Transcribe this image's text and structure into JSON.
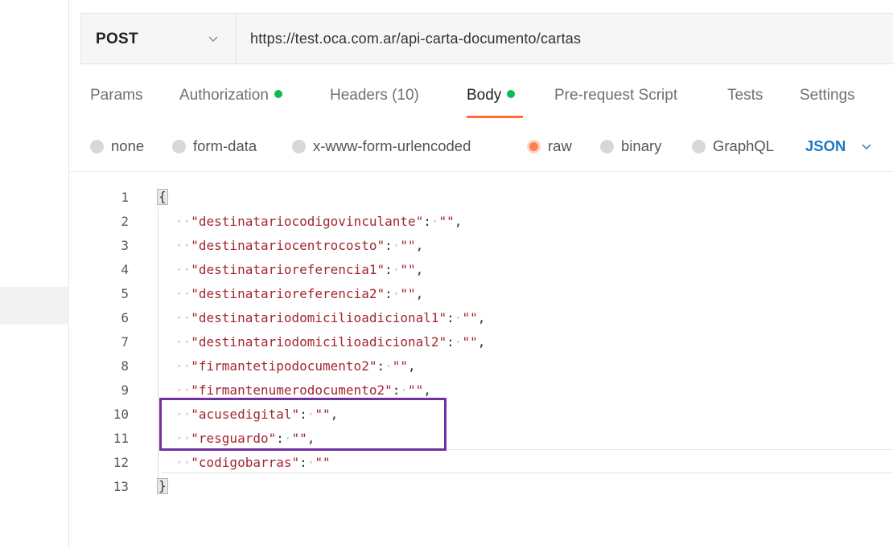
{
  "request": {
    "method": "POST",
    "url": "https://test.oca.com.ar/api-carta-documento/cartas"
  },
  "tabs": [
    {
      "label": "Params",
      "dot": false
    },
    {
      "label": "Authorization",
      "dot": true
    },
    {
      "label": "Headers (10)",
      "dot": false
    },
    {
      "label": "Body",
      "dot": true,
      "active": true
    },
    {
      "label": "Pre-request Script",
      "dot": false
    },
    {
      "label": "Tests",
      "dot": false
    },
    {
      "label": "Settings",
      "dot": false
    }
  ],
  "body_types": {
    "none": "none",
    "form_data": "form-data",
    "urlencoded": "x-www-form-urlencoded",
    "raw": "raw",
    "binary": "binary",
    "graphql": "GraphQL",
    "selected": "raw",
    "format": "JSON"
  },
  "editor": {
    "line_numbers": [
      "1",
      "2",
      "3",
      "4",
      "5",
      "6",
      "7",
      "8",
      "9",
      "10",
      "11",
      "12",
      "13"
    ],
    "open_brace": "{",
    "close_brace": "}",
    "lines": [
      {
        "key": "\"destinatariocodigovinculante\"",
        "value": "\"\"",
        "comma": ","
      },
      {
        "key": "\"destinatariocentrocosto\"",
        "value": "\"\"",
        "comma": ","
      },
      {
        "key": "\"destinatarioreferencia1\"",
        "value": "\"\"",
        "comma": ","
      },
      {
        "key": "\"destinatarioreferencia2\"",
        "value": "\"\"",
        "comma": ","
      },
      {
        "key": "\"destinatariodomicilioadicional1\"",
        "value": "\"\"",
        "comma": ","
      },
      {
        "key": "\"destinatariodomicilioadicional2\"",
        "value": "\"\"",
        "comma": ","
      },
      {
        "key": "\"firmantetipodocumento2\"",
        "value": "\"\"",
        "comma": ","
      },
      {
        "key": "\"firmantenumerodocumento2\"",
        "value": "\"\"",
        "comma": ","
      },
      {
        "key": "\"acusedigital\"",
        "value": "\"\"",
        "comma": ","
      },
      {
        "key": "\"resguardo\"",
        "value": "\"\"",
        "comma": ","
      },
      {
        "key": "\"codigobarras\"",
        "value": "\"\"",
        "comma": ""
      }
    ]
  },
  "colors": {
    "accent": "#ff6c37",
    "dot_green": "#0cbb52",
    "json_blue": "#1f76c8",
    "highlight_box": "#7030a0",
    "json_key": "#a3262f"
  }
}
